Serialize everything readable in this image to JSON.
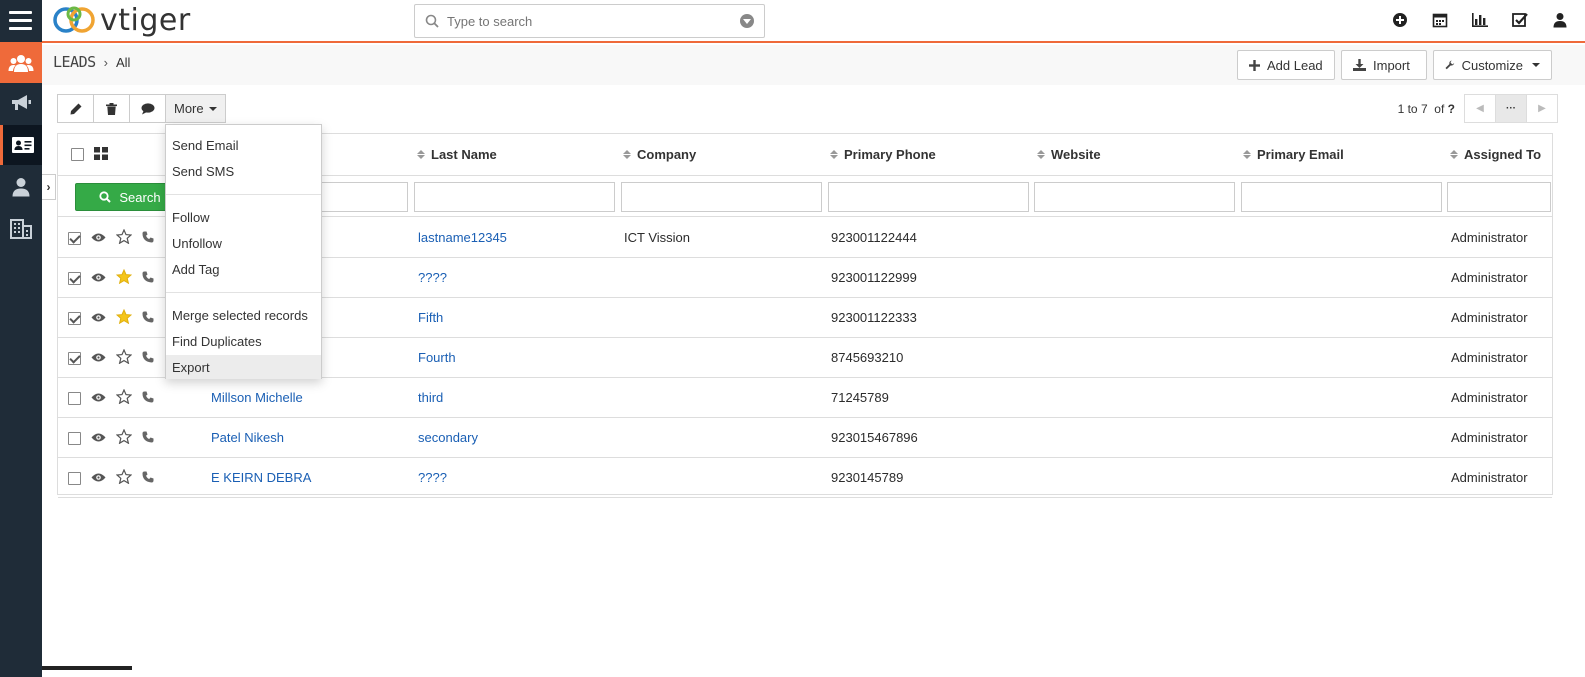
{
  "app": {
    "logo_text": "vtiger"
  },
  "search": {
    "placeholder": "Type to search"
  },
  "top_icons": [
    "plus-circle-icon",
    "calendar-icon",
    "bar-chart-icon",
    "task-check-icon",
    "user-icon"
  ],
  "sidebar": {
    "items": [
      "users-group-icon",
      "megaphone-icon",
      "id-card-icon",
      "person-icon",
      "building-icon"
    ]
  },
  "breadcrumb": {
    "module": "LEADS",
    "view": "All"
  },
  "header_buttons": {
    "add": "Add Lead",
    "import": "Import",
    "customize": "Customize"
  },
  "toolbar": {
    "more": "More"
  },
  "paging": {
    "range": "1 to 7",
    "of_label": "of",
    "total": "?"
  },
  "columns": [
    "Last Name",
    "Company",
    "Primary Phone",
    "Website",
    "Primary Email",
    "Assigned To"
  ],
  "filter": {
    "search_label": "Search"
  },
  "rows": [
    {
      "checked": true,
      "starred": false,
      "first_name": "",
      "last_name": "lastname12345",
      "company": "ICT Vission",
      "phone": "923001122444",
      "website": "",
      "email": "",
      "assigned": "Administrator"
    },
    {
      "checked": true,
      "starred": true,
      "first_name": "",
      "last_name": "????",
      "company": "",
      "phone": "923001122999",
      "website": "",
      "email": "",
      "assigned": "Administrator"
    },
    {
      "checked": true,
      "starred": true,
      "first_name": "",
      "last_name": "Fifth",
      "company": "",
      "phone": "923001122333",
      "website": "",
      "email": "",
      "assigned": "Administrator"
    },
    {
      "checked": true,
      "starred": false,
      "first_name": "",
      "last_name": "Fourth",
      "company": "",
      "phone": "8745693210",
      "website": "",
      "email": "",
      "assigned": "Administrator"
    },
    {
      "checked": false,
      "starred": false,
      "first_name": "Millson Michelle",
      "last_name": "third",
      "company": "",
      "phone": "71245789",
      "website": "",
      "email": "",
      "assigned": "Administrator"
    },
    {
      "checked": false,
      "starred": false,
      "first_name": "Patel Nikesh",
      "last_name": "secondary",
      "company": "",
      "phone": "923015467896",
      "website": "",
      "email": "",
      "assigned": "Administrator"
    },
    {
      "checked": false,
      "starred": false,
      "first_name": "E KEIRN DEBRA",
      "last_name": "????",
      "company": "",
      "phone": "9230145789",
      "website": "",
      "email": "",
      "assigned": "Administrator"
    }
  ],
  "more_menu": {
    "groups": [
      [
        "Send Email",
        "Send SMS"
      ],
      [
        "Follow",
        "Unfollow",
        "Add Tag"
      ],
      [
        "Merge selected records",
        "Find Duplicates",
        "Export"
      ]
    ],
    "highlighted": "Export"
  },
  "colors": {
    "accent": "#ef6a3a",
    "sidebar": "#1f2c38",
    "link": "#1a5fb4",
    "search_button": "#35aa47",
    "star": "#f5c518"
  }
}
